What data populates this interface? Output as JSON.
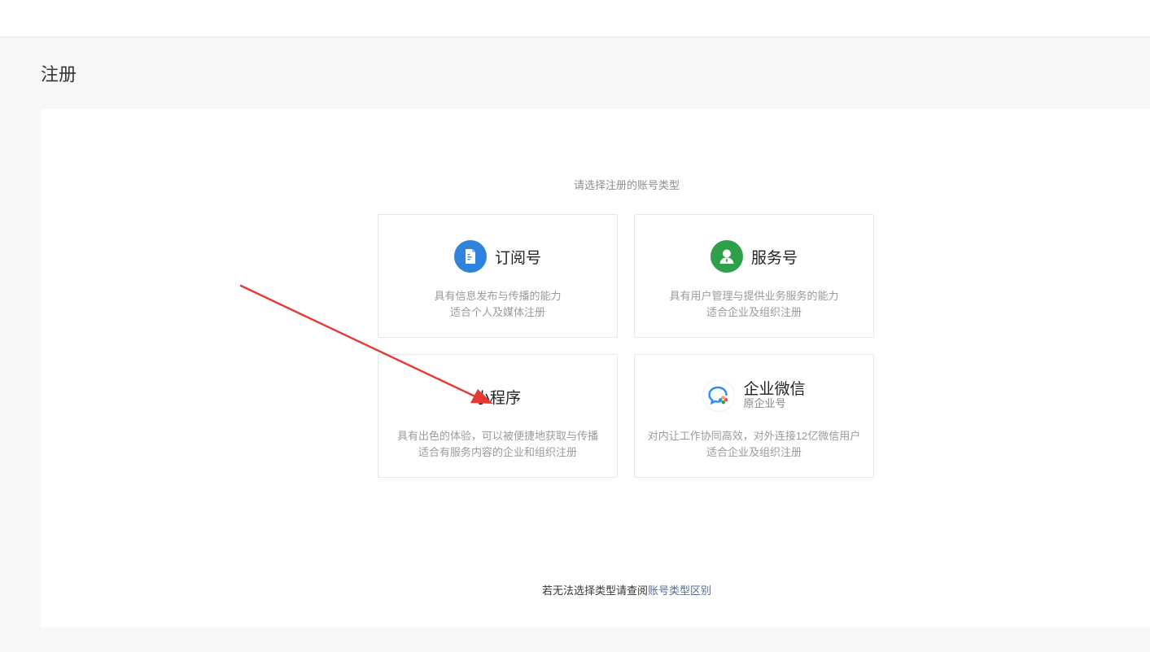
{
  "page": {
    "title": "注册"
  },
  "prompt": "请选择注册的账号类型",
  "cards": {
    "subscription": {
      "icon": "document-icon",
      "color": "#2e83de",
      "title": "订阅号",
      "desc_line1": "具有信息发布与传播的能力",
      "desc_line2": "适合个人及媒体注册"
    },
    "service": {
      "icon": "user-icon",
      "color": "#2ea049",
      "title": "服务号",
      "desc_line1": "具有用户管理与提供业务服务的能力",
      "desc_line2": "适合企业及组织注册"
    },
    "miniprogram": {
      "title": "小程序",
      "desc_line1": "具有出色的体验，可以被便捷地获取与传播",
      "desc_line2": "适合有服务内容的企业和组织注册"
    },
    "wecom": {
      "icon": "chat-bubble-icon",
      "title": "企业微信",
      "subtitle": "原企业号",
      "desc_line1": "对内让工作协同高效，对外连接12亿微信用户",
      "desc_line2": "适合企业及组织注册"
    }
  },
  "footer": {
    "text": "若无法选择类型请查阅",
    "link": "账号类型区别"
  },
  "annotation": {
    "arrow_color": "#e43a33"
  }
}
